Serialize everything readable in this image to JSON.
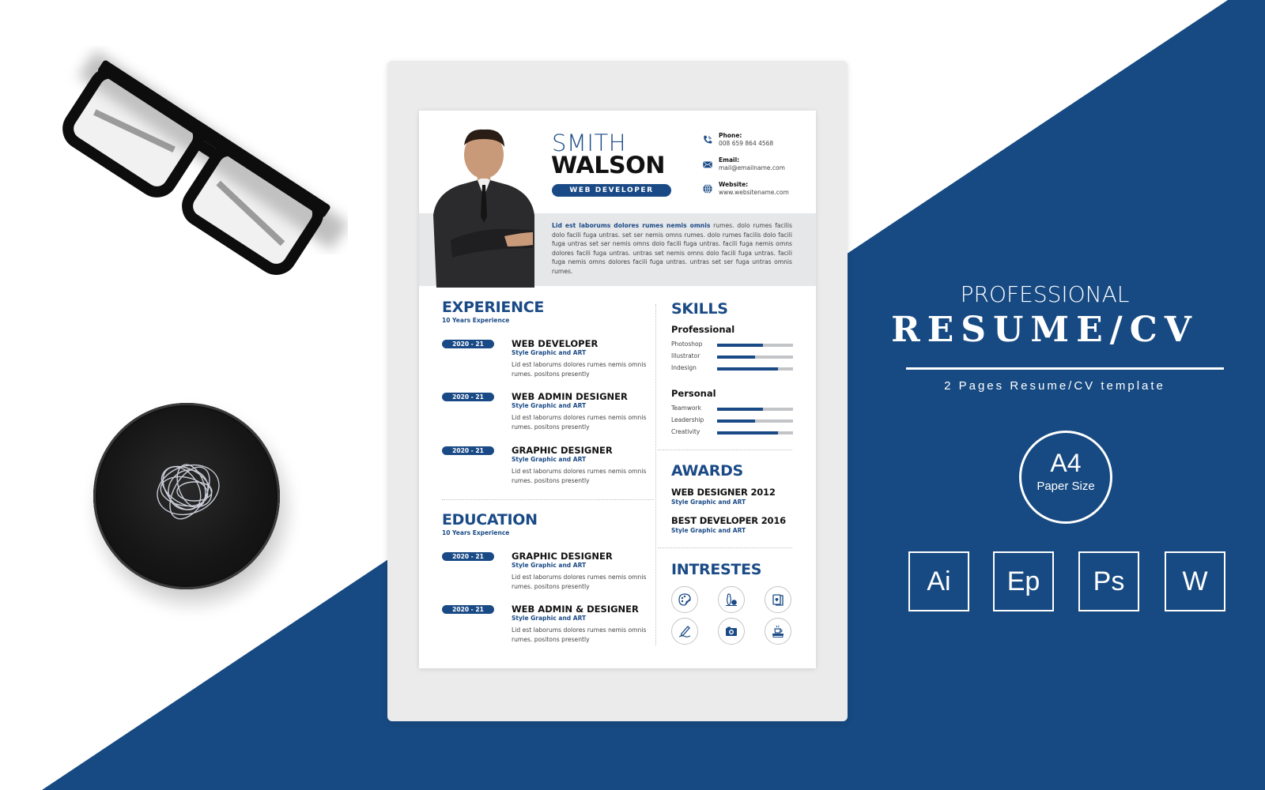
{
  "colors": {
    "brand_blue": "#1a4a86",
    "background_blue": "#174a82",
    "board_gray": "#ebebeb",
    "band_gray": "#e6e7e9"
  },
  "resume": {
    "first_name": "SMITH",
    "last_name": "WALSON",
    "role": "WEB DEVELOPER",
    "contacts": [
      {
        "icon": "phone-icon",
        "label": "Phone:",
        "value": "008 659 864 4568"
      },
      {
        "icon": "email-icon",
        "label": "Email:",
        "value": "mail@emailname.com"
      },
      {
        "icon": "globe-icon",
        "label": "Website:",
        "value": "www.websitename.com"
      }
    ],
    "summary_lead": "Lid est laborums dolores rumes nemis omnis",
    "summary_rest": " rumes. dolo rumes facilis dolo facili fuga untras. set ser nemis omns rumes. dolo rumes facilis dolo facili fuga untras set ser nemis omns dolo facili fuga untras. facili fuga nemis omns dolores facili fuga untras. untras set nemis omns dolo facili fuga untras. facili fuga nemis omns dolores facili fuga untras. untras set ser fuga untras omnis rumes.",
    "experience": {
      "title": "EXPERIENCE",
      "subtitle": "10 Years Experience",
      "items": [
        {
          "date": "2020 - 21",
          "title": "WEB DEVELOPER",
          "sub": "Style Graphic and ART",
          "desc": "Lid est laborums dolores rumes nemis omnis rumes. positons presently"
        },
        {
          "date": "2020 - 21",
          "title": "WEB ADMIN DESIGNER",
          "sub": "Style Graphic and ART",
          "desc": "Lid est laborums dolores rumes nemis omnis rumes. positons presently"
        },
        {
          "date": "2020 - 21",
          "title": "GRAPHIC DESIGNER",
          "sub": "Style Graphic and ART",
          "desc": "Lid est laborums dolores rumes nemis omnis rumes. positons presently"
        }
      ]
    },
    "education": {
      "title": "EDUCATION",
      "subtitle": "10 Years Experience",
      "items": [
        {
          "date": "2020 - 21",
          "title": "GRAPHIC DESIGNER",
          "sub": "Style Graphic and ART",
          "desc": "Lid est laborums dolores rumes nemis omnis rumes. positons presently"
        },
        {
          "date": "2020 - 21",
          "title": "WEB ADMIN & DESIGNER",
          "sub": "Style Graphic and ART",
          "desc": "Lid est laborums dolores rumes nemis omnis rumes. positons presently"
        }
      ]
    },
    "skills": {
      "title": "SKILLS",
      "professional": {
        "label": "Professional",
        "items": [
          {
            "name": "Photoshop",
            "level": 0.6
          },
          {
            "name": "Illustrator",
            "level": 0.5
          },
          {
            "name": "Indesign",
            "level": 0.8
          }
        ]
      },
      "personal": {
        "label": "Personal",
        "items": [
          {
            "name": "Teamwork",
            "level": 0.6
          },
          {
            "name": "Leadership",
            "level": 0.5
          },
          {
            "name": "Creativity",
            "level": 0.8
          }
        ]
      }
    },
    "awards": {
      "title": "AWARDS",
      "items": [
        {
          "title": "WEB DESIGNER 2012",
          "sub": "Style Graphic and ART"
        },
        {
          "title": "BEST DEVELOPER 2016",
          "sub": "Style Graphic and ART"
        }
      ]
    },
    "interests": {
      "title": "INTRESTES",
      "icons": [
        "palette-icon",
        "bowling-icon",
        "playing-cards-icon",
        "pencil-icon",
        "camera-icon",
        "coffee-books-icon"
      ]
    }
  },
  "promo": {
    "kicker": "PROFESSIONAL",
    "headline": "RESUME/CV",
    "subline": "2 Pages Resume/CV template",
    "paper_size": "A4",
    "paper_label": "Paper Size",
    "formats": [
      "Ai",
      "Ep",
      "Ps",
      "W"
    ]
  }
}
